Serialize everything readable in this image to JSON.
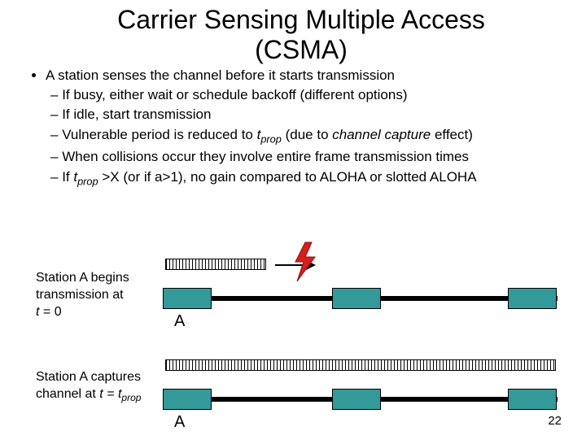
{
  "title_line1": "Carrier Sensing Multiple Access",
  "title_line2": "(CSMA)",
  "bullet_main": "A station senses the channel before it starts transmission",
  "sub": {
    "b1": "If busy, either wait or schedule backoff (different options)",
    "b2": "If idle, start transmission",
    "b3_pre": "Vulnerable period is reduced to ",
    "b3_var": "t",
    "b3_sub": "prop",
    "b3_post": " (due to ",
    "b3_em": "channel capture",
    "b3_tail": " effect)",
    "b4": "When collisions occur they involve entire frame transmission times",
    "b5_pre": "If ",
    "b5_var": "t",
    "b5_sub": "prop",
    "b5_post": " >X (or if a>1), no gain compared to ALOHA or slotted ALOHA"
  },
  "row1": {
    "caption_l1": "Station A begins",
    "caption_l2": "transmission at",
    "caption_l3_pre": "t",
    "caption_l3_post": " = 0",
    "labelA": "A"
  },
  "row2": {
    "caption_l1": "Station A captures",
    "caption_l2_pre": "channel at ",
    "caption_l2_var": "t = t",
    "caption_l2_sub": "prop",
    "labelA": "A"
  },
  "slide_number": "22"
}
